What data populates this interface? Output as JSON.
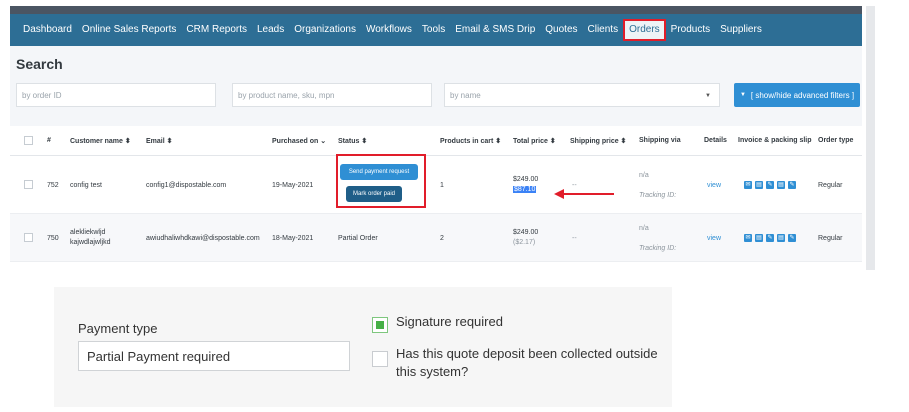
{
  "nav": {
    "items": [
      "Dashboard",
      "Online Sales Reports",
      "CRM Reports",
      "Leads",
      "Organizations",
      "Workflows",
      "Tools",
      "Email & SMS Drip",
      "Quotes",
      "Clients",
      "Orders",
      "Products",
      "Suppliers"
    ],
    "active": "Orders"
  },
  "search": {
    "title": "Search",
    "order_id_placeholder": "by order ID",
    "product_placeholder": "by product name, sku, mpn",
    "name_placeholder": "by name",
    "advanced_button": "[ show/hide advanced filters ]"
  },
  "table": {
    "headers": {
      "num": "#",
      "customer": "Customer name ⬍",
      "email": "Email ⬍",
      "purchased": "Purchased on ⌄",
      "status": "Status ⬍",
      "products": "Products in cart ⬍",
      "total": "Total price ⬍",
      "shipping_price": "Shipping price ⬍",
      "shipping_via": "Shipping via",
      "details": "Details",
      "invoice": "Invoice & packing slip",
      "order_type": "Order type"
    },
    "rows": [
      {
        "num": "752",
        "customer": "config test",
        "email": "config1@dispostable.com",
        "purchased": "19-May-2021",
        "status_buttons": [
          "Send payment request",
          "Mark order paid"
        ],
        "products": "1",
        "total": "$249.00",
        "total_sub": "$87.10",
        "shipping_price": "--",
        "shipping_via": "n/a",
        "tracking": "Tracking ID:",
        "details": "view",
        "order_type": "Regular"
      },
      {
        "num": "750",
        "customer_line1": "alekliekwljd",
        "customer_line2": "kajwdlajwljkd",
        "email": "awiudhaliwhdkawi@dispostable.com",
        "purchased": "18-May-2021",
        "status": "Partial Order",
        "products": "2",
        "total": "$249.00",
        "total_sub": "($2.17)",
        "shipping_price": "--",
        "shipping_via": "n/a",
        "tracking": "Tracking ID:",
        "details": "view",
        "order_type": "Regular"
      }
    ]
  },
  "form": {
    "payment_type_label": "Payment type",
    "payment_type_value": "Partial Payment required",
    "signature_label": "Signature required",
    "signature_checked": true,
    "deposit_line1": "Has this quote deposit been collected outside",
    "deposit_line2": "this system?",
    "deposit_checked": false
  },
  "colors": {
    "nav_bg": "#2d6e95",
    "accent": "#2f8fd4",
    "highlight_border": "#e11d2a",
    "checkbox_on": "#45b045"
  }
}
